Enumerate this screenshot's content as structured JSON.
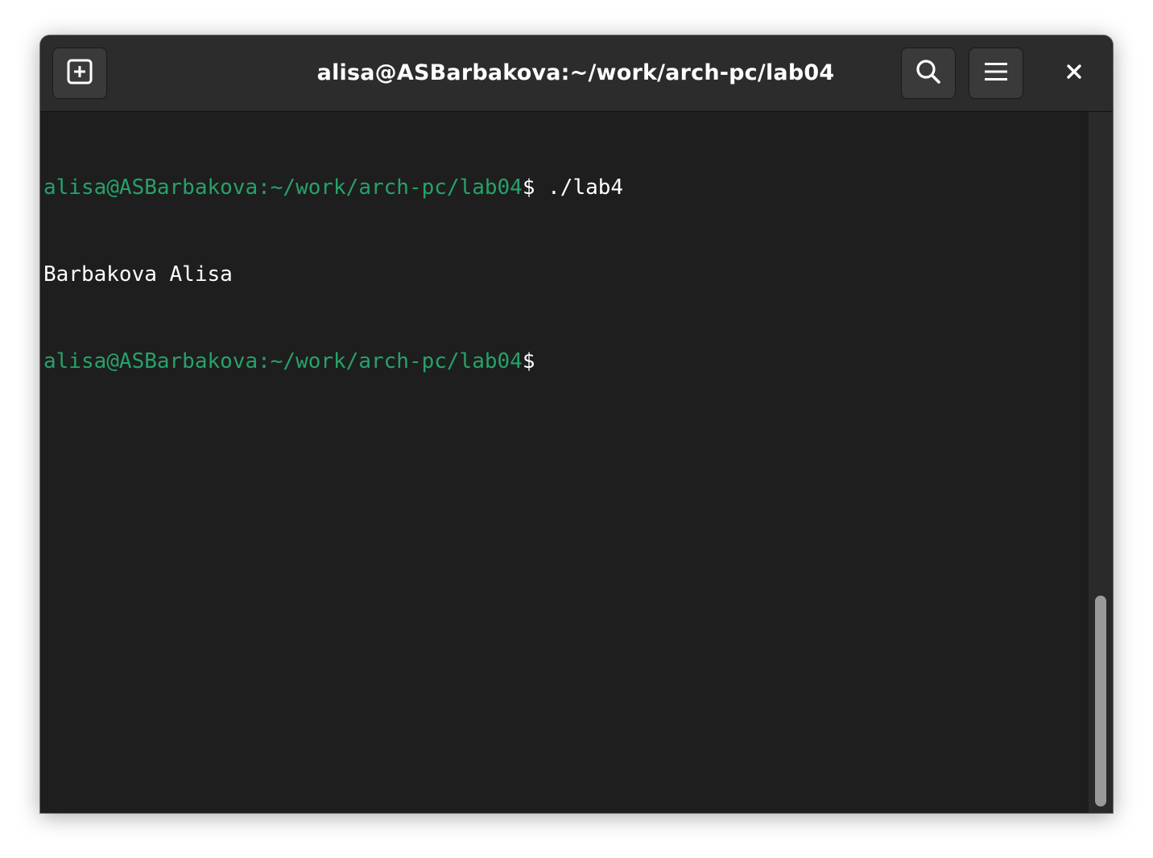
{
  "window": {
    "title": "alisa@ASBarbakova:~/work/arch-pc/lab04"
  },
  "headerbar": {
    "new_tab_icon": "new-tab-icon",
    "search_icon": "search-icon",
    "menu_icon": "hamburger-menu-icon",
    "close_icon": "close-icon"
  },
  "terminal": {
    "lines": [
      {
        "prompt": "alisa@ASBarbakova:~/work/arch-pc/lab04",
        "symbol": "$",
        "command": " ./lab4"
      },
      {
        "output": "Barbakova Alisa"
      },
      {
        "prompt": "alisa@ASBarbakova:~/work/arch-pc/lab04",
        "symbol": "$",
        "command": ""
      }
    ]
  },
  "colors": {
    "prompt": "#26a269",
    "background": "#1e1e1e",
    "headerbar": "#2c2c2c",
    "text": "#ffffff"
  }
}
